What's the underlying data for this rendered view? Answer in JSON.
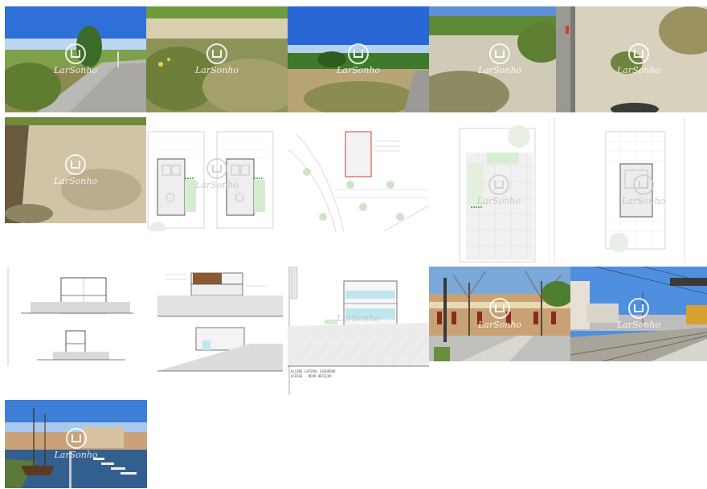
{
  "watermark": {
    "text": "LarSonho"
  },
  "drawing_caption": {
    "line1": "ALÇADO LATERAL ESQUERDO",
    "line2": "ACESSO - NOVO RECEÇÃO"
  },
  "tiles": [
    {
      "name": "photo-land-pathway",
      "kind": "photo"
    },
    {
      "name": "photo-land-vegetation",
      "kind": "photo"
    },
    {
      "name": "photo-land-field",
      "kind": "photo"
    },
    {
      "name": "photo-land-dunes",
      "kind": "photo"
    },
    {
      "name": "photo-land-sand-path",
      "kind": "photo"
    },
    {
      "name": "photo-land-ground",
      "kind": "photo"
    },
    {
      "name": "plan-floor-plans",
      "kind": "drawing"
    },
    {
      "name": "plan-site-location",
      "kind": "drawing"
    },
    {
      "name": "plan-site-implantation",
      "kind": "drawing"
    },
    {
      "name": "plan-roof",
      "kind": "drawing"
    },
    {
      "name": "drawing-sections",
      "kind": "drawing"
    },
    {
      "name": "drawing-elevations",
      "kind": "drawing"
    },
    {
      "name": "drawing-elevation-detail",
      "kind": "drawing"
    },
    {
      "name": "photo-town-square",
      "kind": "photo"
    },
    {
      "name": "photo-metro-station",
      "kind": "photo"
    },
    {
      "name": "photo-harbour",
      "kind": "photo"
    }
  ]
}
